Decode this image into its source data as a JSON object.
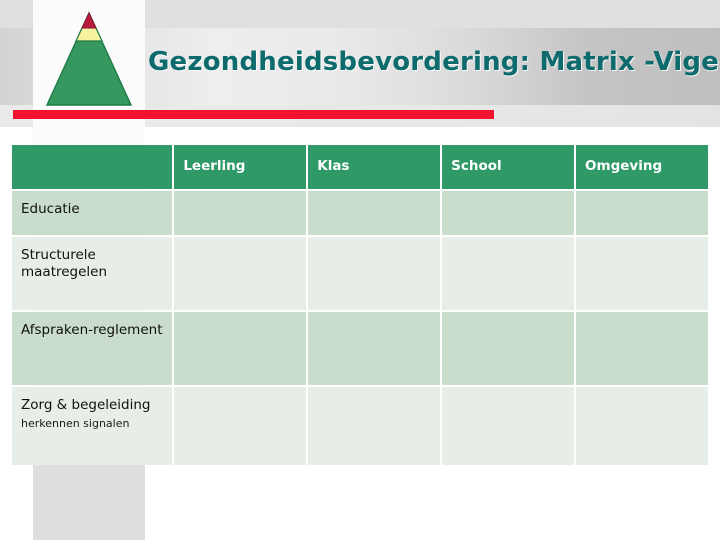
{
  "slide": {
    "title": "Gezondheidsbevordering: Matrix -Vigez",
    "accent_red": "#f5122f",
    "accent_green": "#2f9a68",
    "title_color": "#0d6b6e"
  },
  "logo": {
    "name": "vigez-pyramid-logo",
    "tiers": [
      {
        "label": "top",
        "color": "#b81b3c"
      },
      {
        "label": "middle",
        "color": "#f7f2a0"
      },
      {
        "label": "base",
        "color": "#36985f"
      }
    ],
    "outline_color": "#1e7a46"
  },
  "matrix": {
    "corner_label": "",
    "columns": [
      "Leerling",
      "Klas",
      "School",
      "Omgeving"
    ],
    "rows": [
      {
        "label": "Educatie",
        "sub": "",
        "cells": [
          "",
          "",
          "",
          ""
        ]
      },
      {
        "label": "Structurele maatregelen",
        "sub": "",
        "cells": [
          "",
          "",
          "",
          ""
        ]
      },
      {
        "label": "Afspraken-reglement",
        "sub": "",
        "cells": [
          "",
          "",
          "",
          ""
        ]
      },
      {
        "label": "Zorg & begeleiding",
        "sub": "herkennen signalen",
        "cells": [
          "",
          "",
          "",
          ""
        ]
      }
    ]
  }
}
